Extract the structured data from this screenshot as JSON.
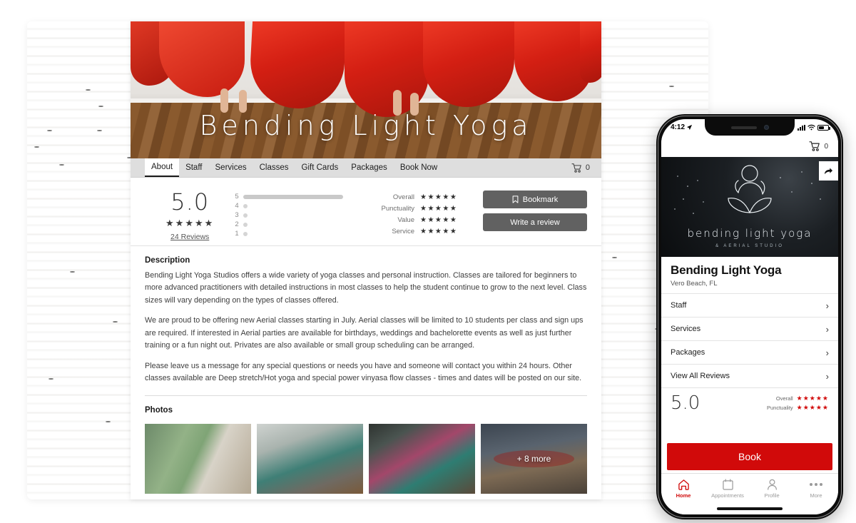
{
  "brand": {
    "accent_red": "#d10a0a",
    "dark_button": "#616161",
    "star_dark": "#2e2e2e"
  },
  "desktop": {
    "hero_title": "Bending Light Yoga",
    "nav": {
      "items": [
        {
          "label": "About",
          "active": true
        },
        {
          "label": "Staff",
          "active": false
        },
        {
          "label": "Services",
          "active": false
        },
        {
          "label": "Classes",
          "active": false
        },
        {
          "label": "Gift Cards",
          "active": false
        },
        {
          "label": "Packages",
          "active": false
        },
        {
          "label": "Book Now",
          "active": false
        }
      ],
      "cart_icon": "cart-icon",
      "cart_count": "0"
    },
    "rating": {
      "score": "5.0",
      "stars": "★★★★★",
      "reviews_link": "24 Reviews",
      "distribution": [
        {
          "label": "5",
          "percent": 100
        },
        {
          "label": "4",
          "percent": 0
        },
        {
          "label": "3",
          "percent": 0
        },
        {
          "label": "2",
          "percent": 0
        },
        {
          "label": "1",
          "percent": 0
        }
      ],
      "metrics": [
        {
          "label": "Overall",
          "stars": "★★★★★"
        },
        {
          "label": "Punctuality",
          "stars": "★★★★★"
        },
        {
          "label": "Value",
          "stars": "★★★★★"
        },
        {
          "label": "Service",
          "stars": "★★★★★"
        }
      ]
    },
    "actions": {
      "bookmark_label": "Bookmark",
      "bookmark_icon": "bookmark-icon",
      "write_review_label": "Write a review"
    },
    "description": {
      "title": "Description",
      "paragraphs": [
        "Bending Light Yoga Studios offers a wide variety of yoga classes and personal instruction. Classes are tailored for beginners to more advanced practitioners with detailed instructions in most classes to help the student continue to grow to the next level. Class sizes will vary depending on the types of classes offered.",
        "We are proud to be offering new Aerial classes starting in July. Aerial classes will be limited to 10 students per class and sign ups are required. If interested in Aerial parties are available for birthdays, weddings and bachelorette events as well as just further training or a fun night out. Privates are also available or small group scheduling can be arranged.",
        " Please leave us a message for any special questions or needs you have and someone will contact you within 24 hours. Other classes available are Deep stretch/Hot yoga and special power vinyasa flow classes - times and dates will be posted on our site."
      ]
    },
    "photos": {
      "title": "Photos",
      "items": [
        {
          "caption": ""
        },
        {
          "caption": ""
        },
        {
          "caption": ""
        },
        {
          "caption": "+ 8 more"
        }
      ]
    }
  },
  "phone": {
    "status": {
      "time": "4:12",
      "location_icon": "location-arrow-icon",
      "signal_icon": "signal-bars-icon",
      "wifi_icon": "wifi-icon",
      "battery_icon": "battery-icon"
    },
    "topbar": {
      "cart_icon": "cart-icon",
      "cart_count": "0"
    },
    "hero": {
      "share_icon": "share-icon",
      "logo_icon": "meditating-figure-icon",
      "logo_name": "bending light yoga",
      "logo_sub": "& AERIAL STUDIO"
    },
    "business": {
      "name": "Bending Light Yoga",
      "location": "Vero Beach, FL"
    },
    "rows": [
      {
        "label": "Staff"
      },
      {
        "label": "Services"
      },
      {
        "label": "Packages"
      },
      {
        "label": "View All Reviews"
      }
    ],
    "rating": {
      "score": "5.0",
      "metrics": [
        {
          "label": "Overall",
          "stars": "★★★★★"
        },
        {
          "label": "Punctuality",
          "stars": "★★★★★"
        }
      ]
    },
    "book_label": "Book",
    "tabs": [
      {
        "label": "Home",
        "icon": "home-icon",
        "active": true
      },
      {
        "label": "Appointments",
        "icon": "calendar-icon",
        "active": false
      },
      {
        "label": "Profile",
        "icon": "person-icon",
        "active": false
      },
      {
        "label": "More",
        "icon": "ellipsis-icon",
        "active": false
      }
    ]
  }
}
